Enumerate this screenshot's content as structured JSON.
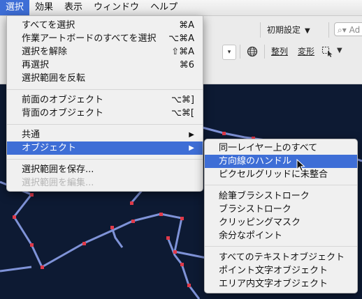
{
  "menubar": {
    "items": [
      "選択",
      "効果",
      "表示",
      "ウィンドウ",
      "ヘルプ"
    ],
    "active_index": 0
  },
  "toolbar": {
    "workspace_label": "初期設定",
    "search_placeholder": "Ad",
    "align_label": "整列",
    "transform_label": "変形"
  },
  "select_menu": {
    "all": {
      "label": "すべてを選択",
      "shortcut": "⌘A"
    },
    "all_artboard": {
      "label": "作業アートボードのすべてを選択",
      "shortcut": "⌥⌘A"
    },
    "deselect": {
      "label": "選択を解除",
      "shortcut": "⇧⌘A"
    },
    "reselect": {
      "label": "再選択",
      "shortcut": "⌘6"
    },
    "inverse": {
      "label": "選択範囲を反転"
    },
    "next_object": {
      "label": "前面のオブジェクト",
      "shortcut": "⌥⌘]"
    },
    "prev_object": {
      "label": "背面のオブジェクト",
      "shortcut": "⌥⌘["
    },
    "same": {
      "label": "共通"
    },
    "object": {
      "label": "オブジェクト"
    },
    "save_selection": {
      "label": "選択範囲を保存..."
    },
    "edit_selection": {
      "label": "選択範囲を編集..."
    }
  },
  "object_submenu": {
    "same_layer": "同一レイヤー上のすべて",
    "direction_handles": "方向線のハンドル",
    "not_aligned_pixel": "ピクセルグリッドに未整合",
    "brush_strokes": "絵筆ブラシストローク",
    "brush_stroke": "ブラシストローク",
    "clipping_mask": "クリッピングマスク",
    "stray_points": "余分なポイント",
    "all_text": "すべてのテキストオブジェクト",
    "point_text": "ポイント文字オブジェクト",
    "area_text": "エリア内文字オブジェクト"
  },
  "colors": {
    "highlight": "#3e6ed6",
    "canvas_bg": "#0d1a33",
    "path_line": "#7f93d8",
    "anchor_point": "#e03a4a"
  }
}
